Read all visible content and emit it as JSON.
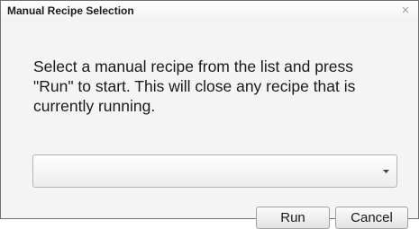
{
  "dialog": {
    "title": "Manual Recipe Selection",
    "message": "Select a manual recipe from the list and press \"Run\" to start. This will close any recipe that is currently running.",
    "close_icon": "close-x-icon",
    "recipe_select": {
      "value": "",
      "icon": "chevron-down-icon"
    },
    "buttons": {
      "run_label": "Run",
      "cancel_label": "Cancel"
    }
  },
  "colors": {
    "content_background": "#f4f4f4",
    "title_text": "#1a1a1a",
    "border": "#707070"
  }
}
